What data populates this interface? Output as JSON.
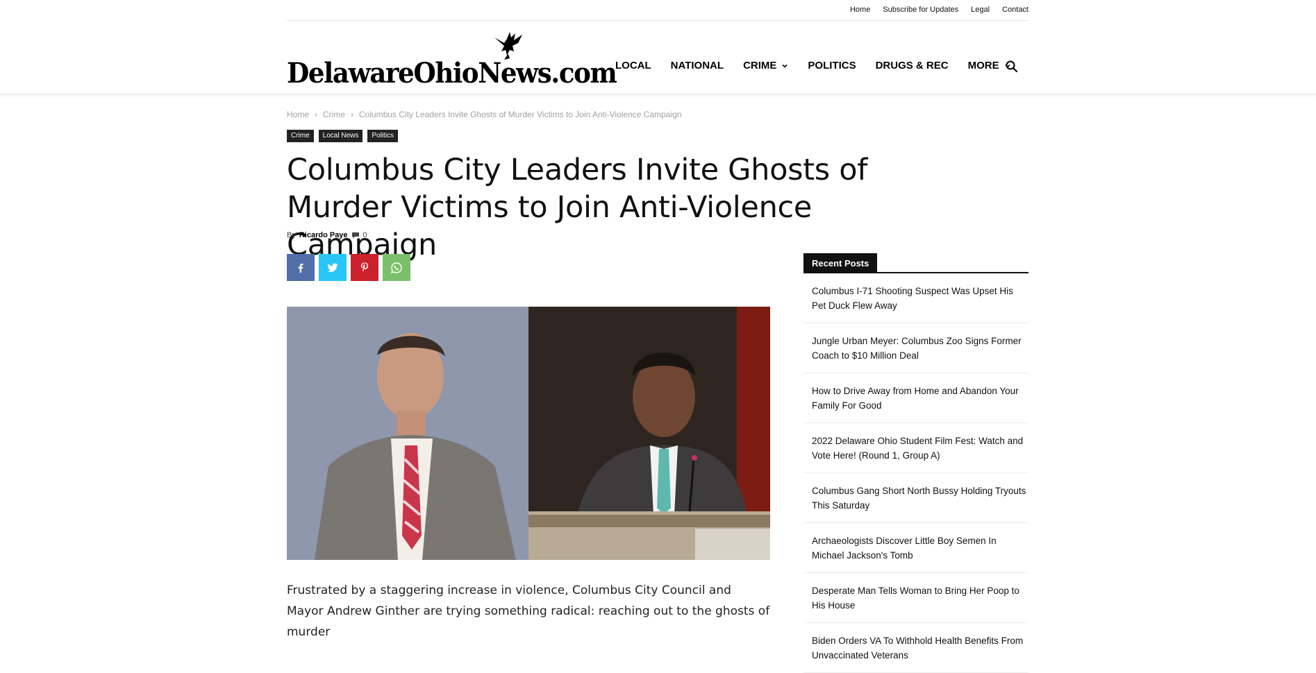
{
  "top_links": [
    "Home",
    "Subscribe for Updates",
    "Legal",
    "Contact"
  ],
  "logo": {
    "text": "DelawareOhioNews.com"
  },
  "nav": {
    "items": [
      {
        "label": "LOCAL",
        "dropdown": false
      },
      {
        "label": "NATIONAL",
        "dropdown": false
      },
      {
        "label": "CRIME",
        "dropdown": true
      },
      {
        "label": "POLITICS",
        "dropdown": false
      },
      {
        "label": "DRUGS & REC",
        "dropdown": false
      },
      {
        "label": "MORE",
        "dropdown": true
      }
    ],
    "search_icon": "search-icon"
  },
  "breadcrumb": [
    "Home",
    "Crime",
    "Columbus City Leaders Invite Ghosts of Murder Victims to Join Anti-Violence Campaign"
  ],
  "tags": [
    "Crime",
    "Local News",
    "Politics"
  ],
  "article": {
    "title": "Columbus City Leaders Invite Ghosts of Murder Victims to Join Anti-Violence Campaign",
    "by": "By",
    "author": "Ricardo Paye",
    "comment_count": "0",
    "body_start": "Frustrated by a staggering increase in violence, Columbus City Council and Mayor Andrew Ginther are trying something radical: reaching out to the ghosts of murder"
  },
  "share": [
    {
      "name": "facebook",
      "color": "#516eab"
    },
    {
      "name": "twitter",
      "color": "#29c5f6"
    },
    {
      "name": "pinterest",
      "color": "#ca212a"
    },
    {
      "name": "whatsapp",
      "color": "#7bbf6a"
    }
  ],
  "sidebar": {
    "heading": "Recent Posts",
    "posts": [
      "Columbus I-71 Shooting Suspect Was Upset His Pet Duck Flew Away",
      "Jungle Urban Meyer: Columbus Zoo Signs Former Coach to $10 Million Deal",
      "How to Drive Away from Home and Abandon Your Family For Good",
      "2022 Delaware Ohio Student Film Fest: Watch and Vote Here! (Round 1, Group A)",
      "Columbus Gang Short North Bussy Holding Tryouts This Saturday",
      "Archaeologists Discover Little Boy Semen In Michael Jackson's Tomb",
      "Desperate Man Tells Woman to Bring Her Poop to His House",
      "Biden Orders VA To Withhold Health Benefits From Unvaccinated Veterans"
    ]
  }
}
